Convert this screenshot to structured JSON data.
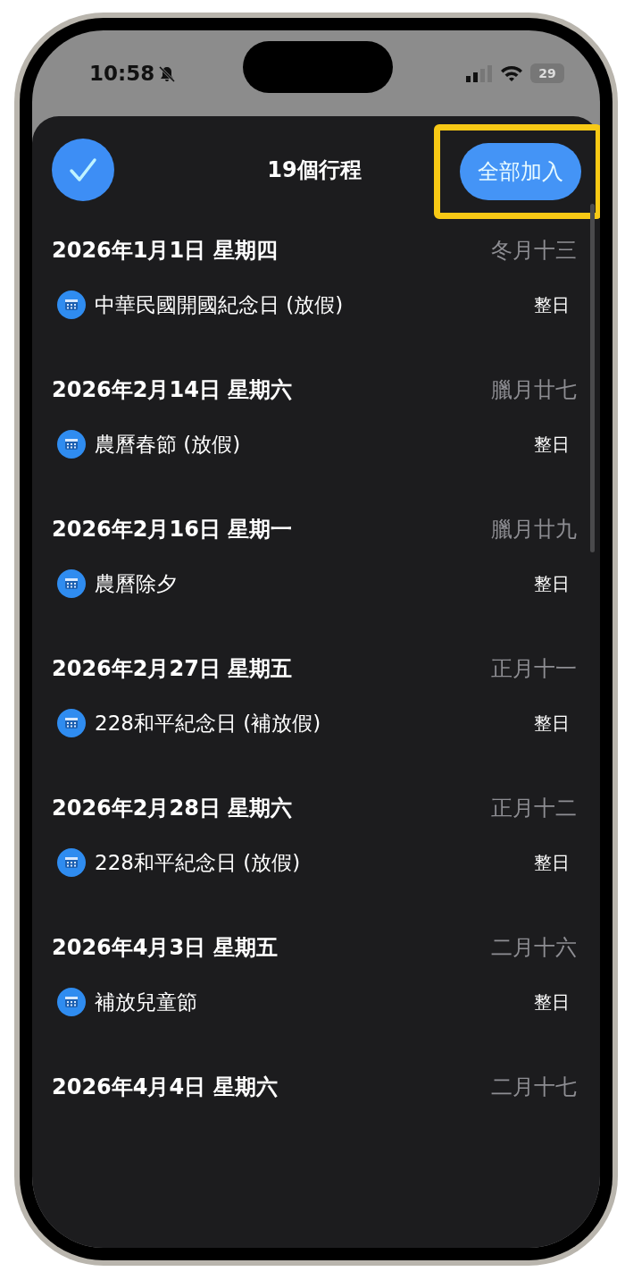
{
  "status_bar": {
    "time": "10:58",
    "silent": true,
    "battery": "29"
  },
  "header": {
    "confirm_selected": true,
    "title": "19個行程",
    "add_all_button": {
      "label": "全部加入",
      "highlighted": true
    }
  },
  "days": [
    {
      "date": "2026年1月1日 星期四",
      "lunar": "冬月十三",
      "events": [
        {
          "title": "中華民國開國紀念日 (放假)",
          "time": "整日"
        }
      ]
    },
    {
      "date": "2026年2月14日 星期六",
      "lunar": "臘月廿七",
      "events": [
        {
          "title": "農曆春節 (放假)",
          "time": "整日"
        }
      ]
    },
    {
      "date": "2026年2月16日 星期一",
      "lunar": "臘月廿九",
      "events": [
        {
          "title": "農曆除夕",
          "time": "整日"
        }
      ]
    },
    {
      "date": "2026年2月27日 星期五",
      "lunar": "正月十一",
      "events": [
        {
          "title": "228和平紀念日 (補放假)",
          "time": "整日"
        }
      ]
    },
    {
      "date": "2026年2月28日 星期六",
      "lunar": "正月十二",
      "events": [
        {
          "title": "228和平紀念日 (放假)",
          "time": "整日"
        }
      ]
    },
    {
      "date": "2026年4月3日 星期五",
      "lunar": "二月十六",
      "events": [
        {
          "title": "補放兒童節",
          "time": "整日"
        }
      ]
    },
    {
      "date": "2026年4月4日 星期六",
      "lunar": "二月十七"
    }
  ]
}
